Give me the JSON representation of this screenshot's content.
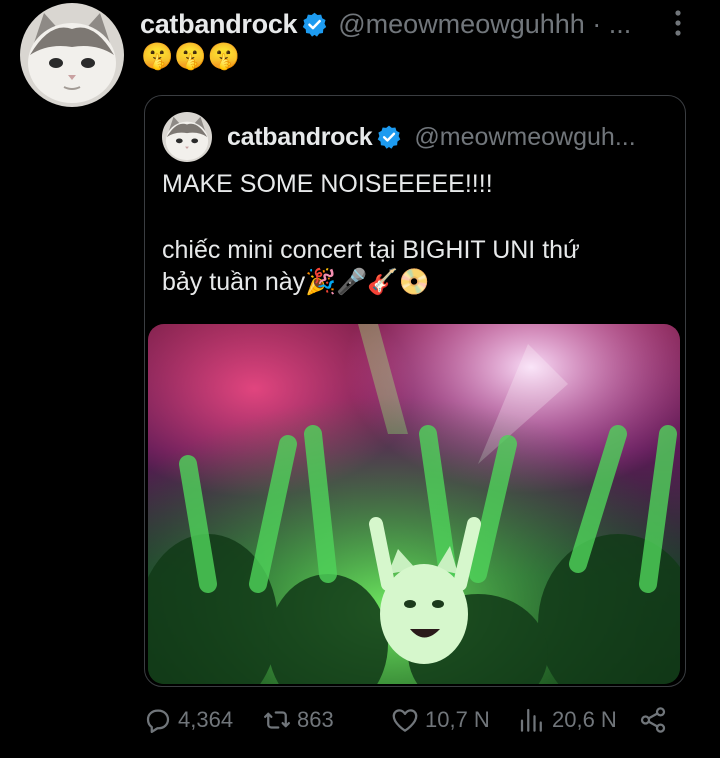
{
  "tweet": {
    "display_name": "catbandrock",
    "handle": "@meowmeowguhhh · ...",
    "body": "🤫🤫🤫",
    "verified": true,
    "avatar_icon": "cat-avatar-icon",
    "more_icon": "more-vertical-icon"
  },
  "quoted_tweet": {
    "display_name": "catbandrock",
    "handle": "@meowmeowguh...",
    "verified": true,
    "line1": "MAKE SOME NOISEEEEE!!!!",
    "line2": "chiếc mini concert tại BIGHIT UNI thứ",
    "line3": "bảy tuần này🎉🎤🎸📀",
    "media_description_icon": "concert-crowd-cat-image"
  },
  "actions": {
    "replies": "4,364",
    "retweets": "863",
    "likes": "10,7 N",
    "views": "20,6 N",
    "icons": [
      "reply-icon",
      "retweet-icon",
      "like-icon",
      "views-icon",
      "share-icon"
    ]
  },
  "colors": {
    "background": "#000000",
    "text_primary": "#e7e9ea",
    "text_secondary": "#71767b",
    "verified_blue": "#1d9bf0",
    "border": "#3a3d41"
  }
}
